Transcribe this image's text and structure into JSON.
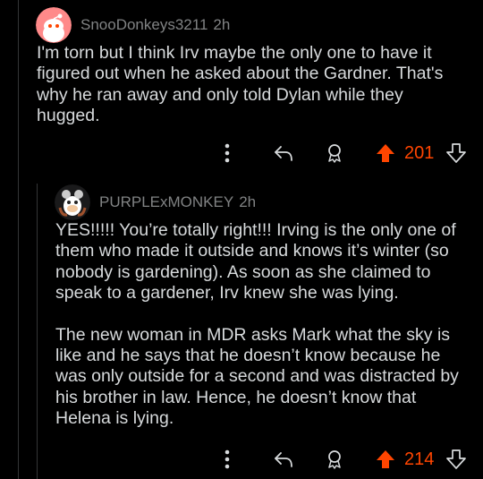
{
  "comments": [
    {
      "username": "SnooDonkeys3211",
      "age": "2h",
      "paragraphs": [
        "I'm torn but I think Irv maybe the only one to have it figured out when he asked about the Gardner. That's why he ran away and only told Dylan while they hugged."
      ],
      "score": "201",
      "actions": {
        "more": "more-vertical-icon",
        "reply": "reply-arrow-icon",
        "award": "award-icon",
        "upvote": "upvote-arrow-icon",
        "downvote": "downvote-arrow-icon"
      }
    },
    {
      "username": "PURPLExMONKEY",
      "age": "2h",
      "paragraphs": [
        "YES!!!!! You’re totally right!!! Irving is the only one of them who made it outside and knows it’s winter (so nobody is gardening). As soon as she claimed to speak to a gardener, Irv knew she was lying.",
        "The new woman in MDR asks Mark what the sky is like and he says that he doesn’t know because he was only outside for a second and was distracted by his brother in law. Hence, he doesn’t know that Helena is lying."
      ],
      "score": "214",
      "actions": {
        "more": "more-vertical-icon",
        "reply": "reply-arrow-icon",
        "award": "award-icon",
        "upvote": "upvote-arrow-icon",
        "downvote": "downvote-arrow-icon"
      }
    }
  ],
  "colors": {
    "background": "#000000",
    "text": "#d7dadc",
    "meta": "#818384",
    "upvoted": "#ff4500",
    "thread_line": "#343536"
  }
}
